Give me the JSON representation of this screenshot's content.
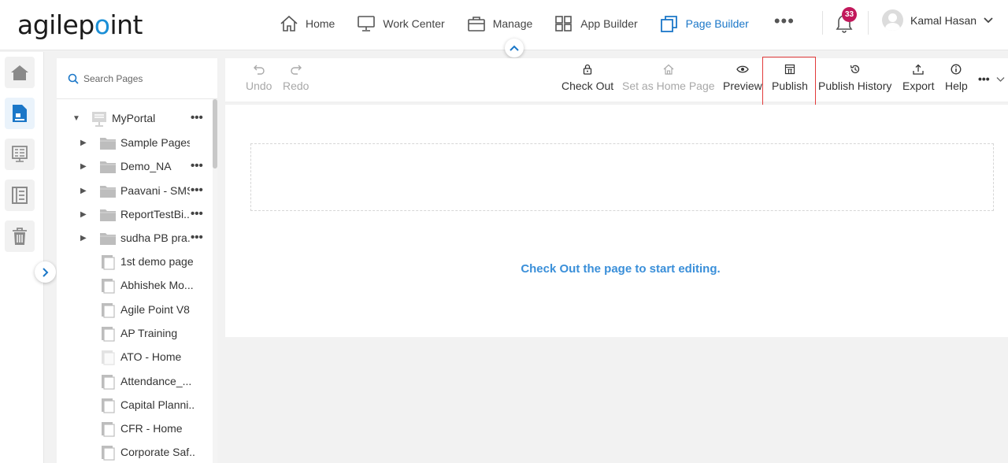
{
  "header": {
    "logo_text_1": "agilep",
    "logo_text_2": "o",
    "logo_text_3": "int",
    "nav": [
      {
        "label": "Home",
        "icon": "home-icon"
      },
      {
        "label": "Work Center",
        "icon": "monitor-icon"
      },
      {
        "label": "Manage",
        "icon": "briefcase-icon"
      },
      {
        "label": "App Builder",
        "icon": "grid-icon"
      },
      {
        "label": "Page Builder",
        "icon": "copy-icon",
        "active": true
      }
    ],
    "more": "•••",
    "notification_count": "33",
    "user_name": "Kamal Hasan"
  },
  "search": {
    "placeholder": "Search Pages"
  },
  "tree": {
    "root": "MyPortal",
    "folders": [
      "Sample Pages",
      "Demo_NA",
      "Paavani - SMS",
      "ReportTestBi...",
      "sudha PB pra..."
    ],
    "pages": [
      "1st demo page",
      "Abhishek Mo...",
      "Agile Point V8",
      "AP Training",
      "ATO - Home",
      "Attendance_...",
      "Capital Planni...",
      "CFR - Home",
      "Corporate Saf..."
    ],
    "dots": "•••"
  },
  "toolbar": {
    "undo": "Undo",
    "redo": "Redo",
    "check_out": "Check Out",
    "set_home": "Set as Home Page",
    "preview": "Preview",
    "publish": "Publish",
    "publish_history": "Publish History",
    "export": "Export",
    "help": "Help",
    "more": "•••"
  },
  "canvas": {
    "hint": "Check Out the page to start editing."
  },
  "colors": {
    "accent": "#1b77c8",
    "highlight": "#e23b3b",
    "badge": "#c2185b"
  }
}
